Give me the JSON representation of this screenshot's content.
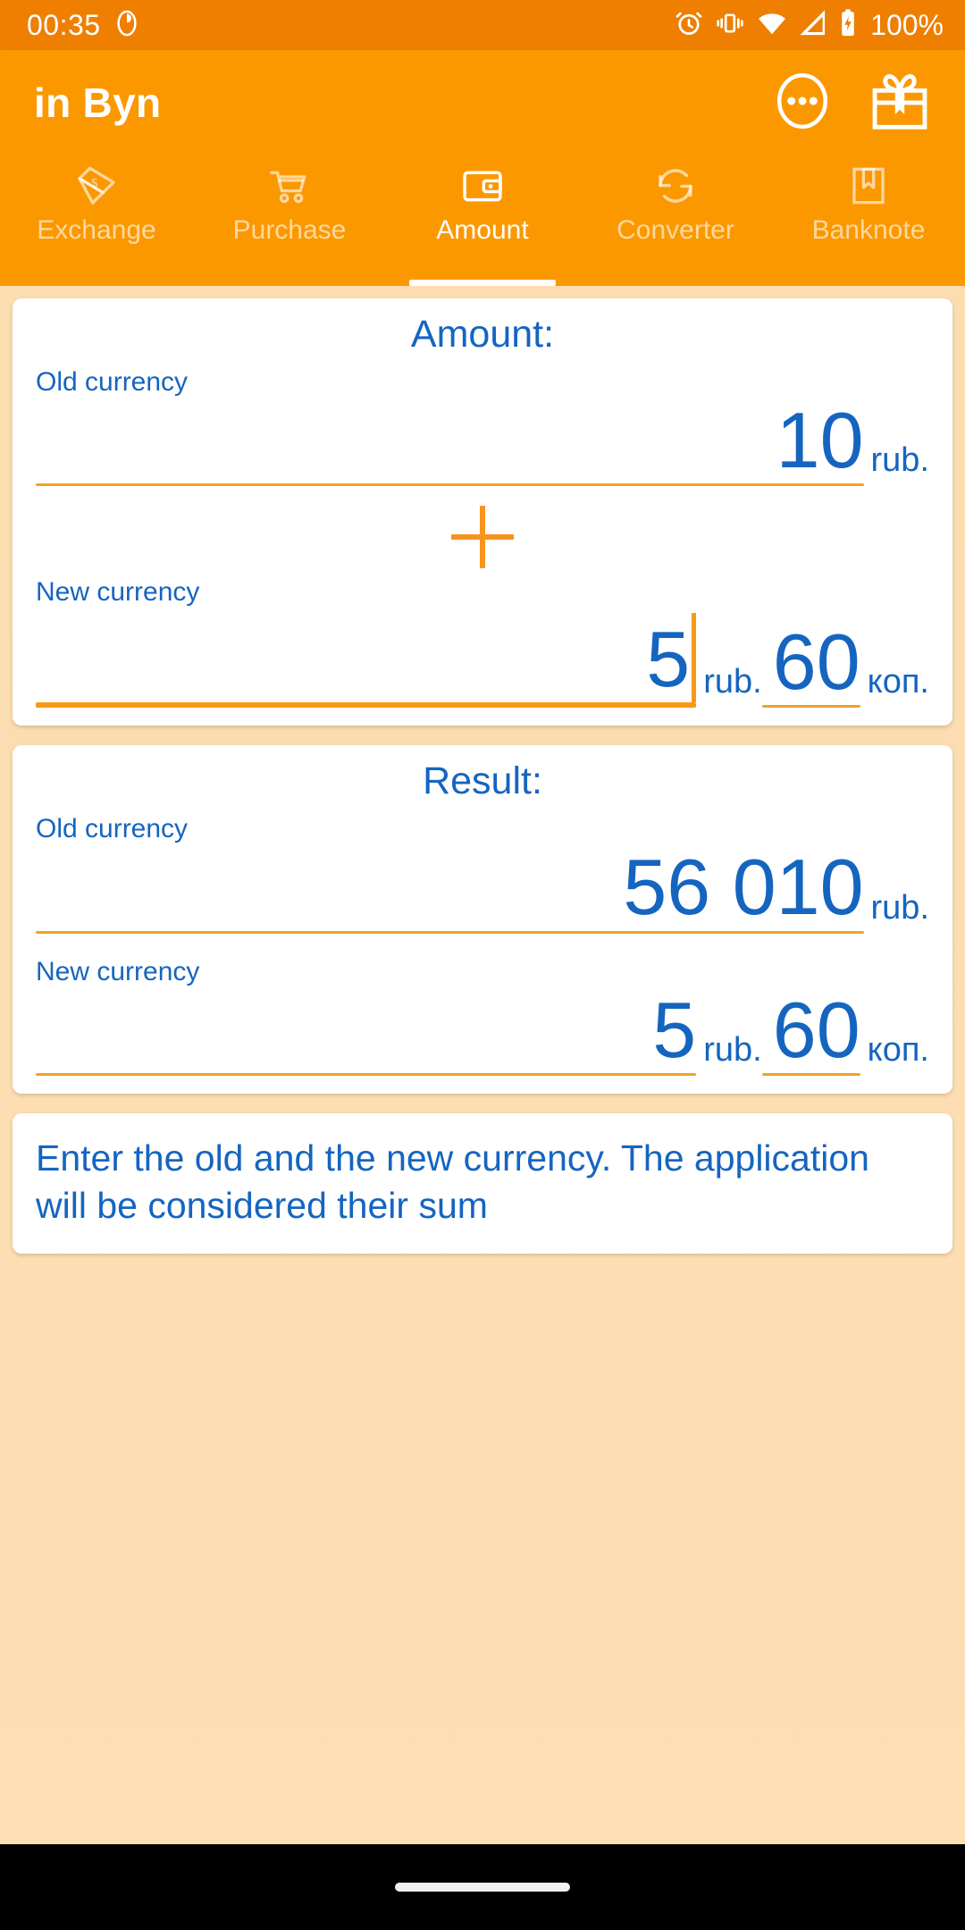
{
  "status_bar": {
    "time": "00:35",
    "battery_text": "100%",
    "icons": [
      "app-notification-icon",
      "alarm-icon",
      "vibrate-icon",
      "wifi-icon",
      "signal-icon",
      "battery-icon"
    ]
  },
  "app_bar": {
    "title": "in Byn",
    "actions": [
      {
        "name": "overflow-menu-icon",
        "label": "More options"
      },
      {
        "name": "gift-icon",
        "label": "Gift"
      }
    ]
  },
  "tabs": [
    {
      "label": "Exchange",
      "icon": "banknote-icon",
      "active": false
    },
    {
      "label": "Purchase",
      "icon": "shopping-cart-icon",
      "active": false
    },
    {
      "label": "Amount",
      "icon": "wallet-icon",
      "active": true
    },
    {
      "label": "Converter",
      "icon": "refresh-icon",
      "active": false
    },
    {
      "label": "Banknote",
      "icon": "bookmark-icon",
      "active": false
    }
  ],
  "amount_card": {
    "title": "Amount:",
    "old_label": "Old currency",
    "old_value": "10",
    "old_unit": "rub.",
    "operator": "+",
    "new_label": "New currency",
    "new_rub_value": "5",
    "new_rub_unit": "rub.",
    "new_kop_value": "60",
    "new_kop_unit": "коп."
  },
  "result_card": {
    "title": "Result:",
    "old_label": "Old currency",
    "old_value": "56 010",
    "old_unit": "rub.",
    "new_label": "New currency",
    "new_rub_value": "5",
    "new_rub_unit": "rub.",
    "new_kop_value": "60",
    "new_kop_unit": "коп."
  },
  "hint": {
    "text": "Enter the old and the new currency. The application will be considered their sum"
  },
  "colors": {
    "status_bar": "#ee7f00",
    "app_bar": "#fb9800",
    "background": "#fddfb2",
    "accent_blue": "#1565c0",
    "rule_orange": "#f0a327",
    "caret_orange": "#f59a16"
  }
}
